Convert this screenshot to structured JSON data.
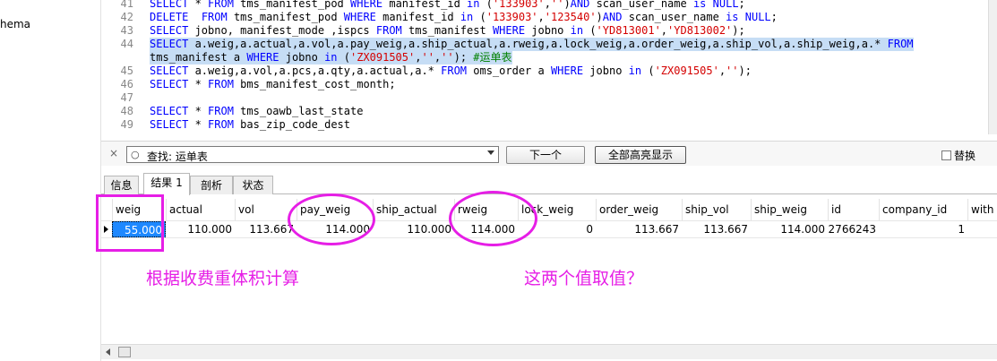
{
  "left_pane": {
    "schema_label": "hema"
  },
  "editor": {
    "lines": [
      {
        "n": "41",
        "segs": [
          [
            "kw",
            "SELECT"
          ],
          [
            "plain",
            " * "
          ],
          [
            "kw",
            "FROM"
          ],
          [
            "plain",
            " tms_manifest_pod "
          ],
          [
            "kw",
            "WHERE"
          ],
          [
            "plain",
            " manifest_id "
          ],
          [
            "kw",
            "in"
          ],
          [
            "plain",
            " ("
          ],
          [
            "str",
            "'133903'"
          ],
          [
            "plain",
            ","
          ],
          [
            "str",
            "''"
          ],
          [
            "plain",
            ")"
          ],
          [
            "kw",
            "AND"
          ],
          [
            "plain",
            " scan_user_name "
          ],
          [
            "kw",
            "is"
          ],
          [
            "plain",
            " "
          ],
          [
            "kw",
            "NULL"
          ],
          [
            "plain",
            ";"
          ]
        ]
      },
      {
        "n": "42",
        "segs": [
          [
            "kw",
            "DELETE"
          ],
          [
            "plain",
            "  "
          ],
          [
            "kw",
            "FROM"
          ],
          [
            "plain",
            " tms_manifest_pod "
          ],
          [
            "kw",
            "WHERE"
          ],
          [
            "plain",
            " manifest_id "
          ],
          [
            "kw",
            "in"
          ],
          [
            "plain",
            " ("
          ],
          [
            "str",
            "'133903'"
          ],
          [
            "plain",
            ","
          ],
          [
            "str",
            "'123540'"
          ],
          [
            "plain",
            ")"
          ],
          [
            "kw",
            "AND"
          ],
          [
            "plain",
            " scan_user_name "
          ],
          [
            "kw",
            "is"
          ],
          [
            "plain",
            " "
          ],
          [
            "kw",
            "NULL"
          ],
          [
            "plain",
            ";"
          ]
        ]
      },
      {
        "n": "43",
        "segs": [
          [
            "kw",
            "SELECT"
          ],
          [
            "plain",
            " jobno, manifest_mode ,ispcs "
          ],
          [
            "kw",
            "FROM"
          ],
          [
            "plain",
            " tms_manifest "
          ],
          [
            "kw",
            "WHERE"
          ],
          [
            "plain",
            " jobno "
          ],
          [
            "kw",
            "in"
          ],
          [
            "plain",
            " ("
          ],
          [
            "str",
            "'YD813001'"
          ],
          [
            "plain",
            ","
          ],
          [
            "str",
            "'YD813002'"
          ],
          [
            "plain",
            ");"
          ]
        ]
      },
      {
        "n": "44",
        "hl": true,
        "segs": [
          [
            "kw",
            "SELECT"
          ],
          [
            "plain",
            " a.weig,a.actual,a.vol,a.pay_weig,a.ship_actual,a.rweig,a.lock_weig,a.order_weig,a.ship_vol,a.ship_weig,a.* "
          ],
          [
            "kw",
            "FROM"
          ]
        ]
      },
      {
        "n": "",
        "hl": true,
        "segs": [
          [
            "plain",
            "tms_manifest a "
          ],
          [
            "kw",
            "WHERE"
          ],
          [
            "plain",
            " jobno "
          ],
          [
            "kw",
            "in"
          ],
          [
            "plain",
            " ("
          ],
          [
            "str",
            "'ZX091505'"
          ],
          [
            "plain",
            ","
          ],
          [
            "str",
            "''"
          ],
          [
            "plain",
            ","
          ],
          [
            "str",
            "''"
          ],
          [
            "plain",
            "); "
          ],
          [
            "cmt",
            "#运单表"
          ]
        ]
      },
      {
        "n": "45",
        "segs": [
          [
            "kw",
            "SELECT"
          ],
          [
            "plain",
            " a.weig,a.vol,a.pcs,a.qty,a.actual,a.* "
          ],
          [
            "kw",
            "FROM"
          ],
          [
            "plain",
            " oms_order a "
          ],
          [
            "kw",
            "WHERE"
          ],
          [
            "plain",
            " jobno "
          ],
          [
            "kw",
            "in"
          ],
          [
            "plain",
            " ("
          ],
          [
            "str",
            "'ZX091505'"
          ],
          [
            "plain",
            ","
          ],
          [
            "str",
            "''"
          ],
          [
            "plain",
            ");"
          ]
        ]
      },
      {
        "n": "46",
        "segs": [
          [
            "kw",
            "SELECT"
          ],
          [
            "plain",
            " * "
          ],
          [
            "kw",
            "FROM"
          ],
          [
            "plain",
            " bms_manifest_cost_month;"
          ]
        ]
      },
      {
        "n": "47",
        "segs": []
      },
      {
        "n": "48",
        "segs": [
          [
            "kw",
            "SELECT"
          ],
          [
            "plain",
            " * "
          ],
          [
            "kw",
            "FROM"
          ],
          [
            "plain",
            " tms_oawb_last_state"
          ]
        ]
      },
      {
        "n": "49",
        "segs": [
          [
            "kw",
            "SELECT"
          ],
          [
            "plain",
            " * "
          ],
          [
            "kw",
            "FROM"
          ],
          [
            "plain",
            " bas_zip_code_dest"
          ]
        ]
      }
    ]
  },
  "findbar": {
    "close": "×",
    "search_icon": "search-icon",
    "search_value": "查找: 运单表",
    "next_label": "下一个",
    "highlight_all_label": "全部高亮显示",
    "replace_label": "替换"
  },
  "tabs": {
    "info": "信息",
    "result": "结果 1",
    "profile": "剖析",
    "status": "状态"
  },
  "grid": {
    "columns": [
      "weig",
      "actual",
      "vol",
      "pay_weig",
      "ship_actual",
      "rweig",
      "lock_weig",
      "order_weig",
      "ship_vol",
      "ship_weig",
      "id",
      "company_id",
      "with"
    ],
    "row": [
      "55.000",
      "110.000",
      "113.667",
      "114.000",
      "110.000",
      "114.000",
      "0",
      "113.667",
      "113.667",
      "114.000",
      "2766243",
      "1",
      ""
    ]
  },
  "annotations": {
    "note_left": "根据收费重体积计算",
    "note_right": "这两个值取值？",
    "color": "#e61ee6"
  }
}
